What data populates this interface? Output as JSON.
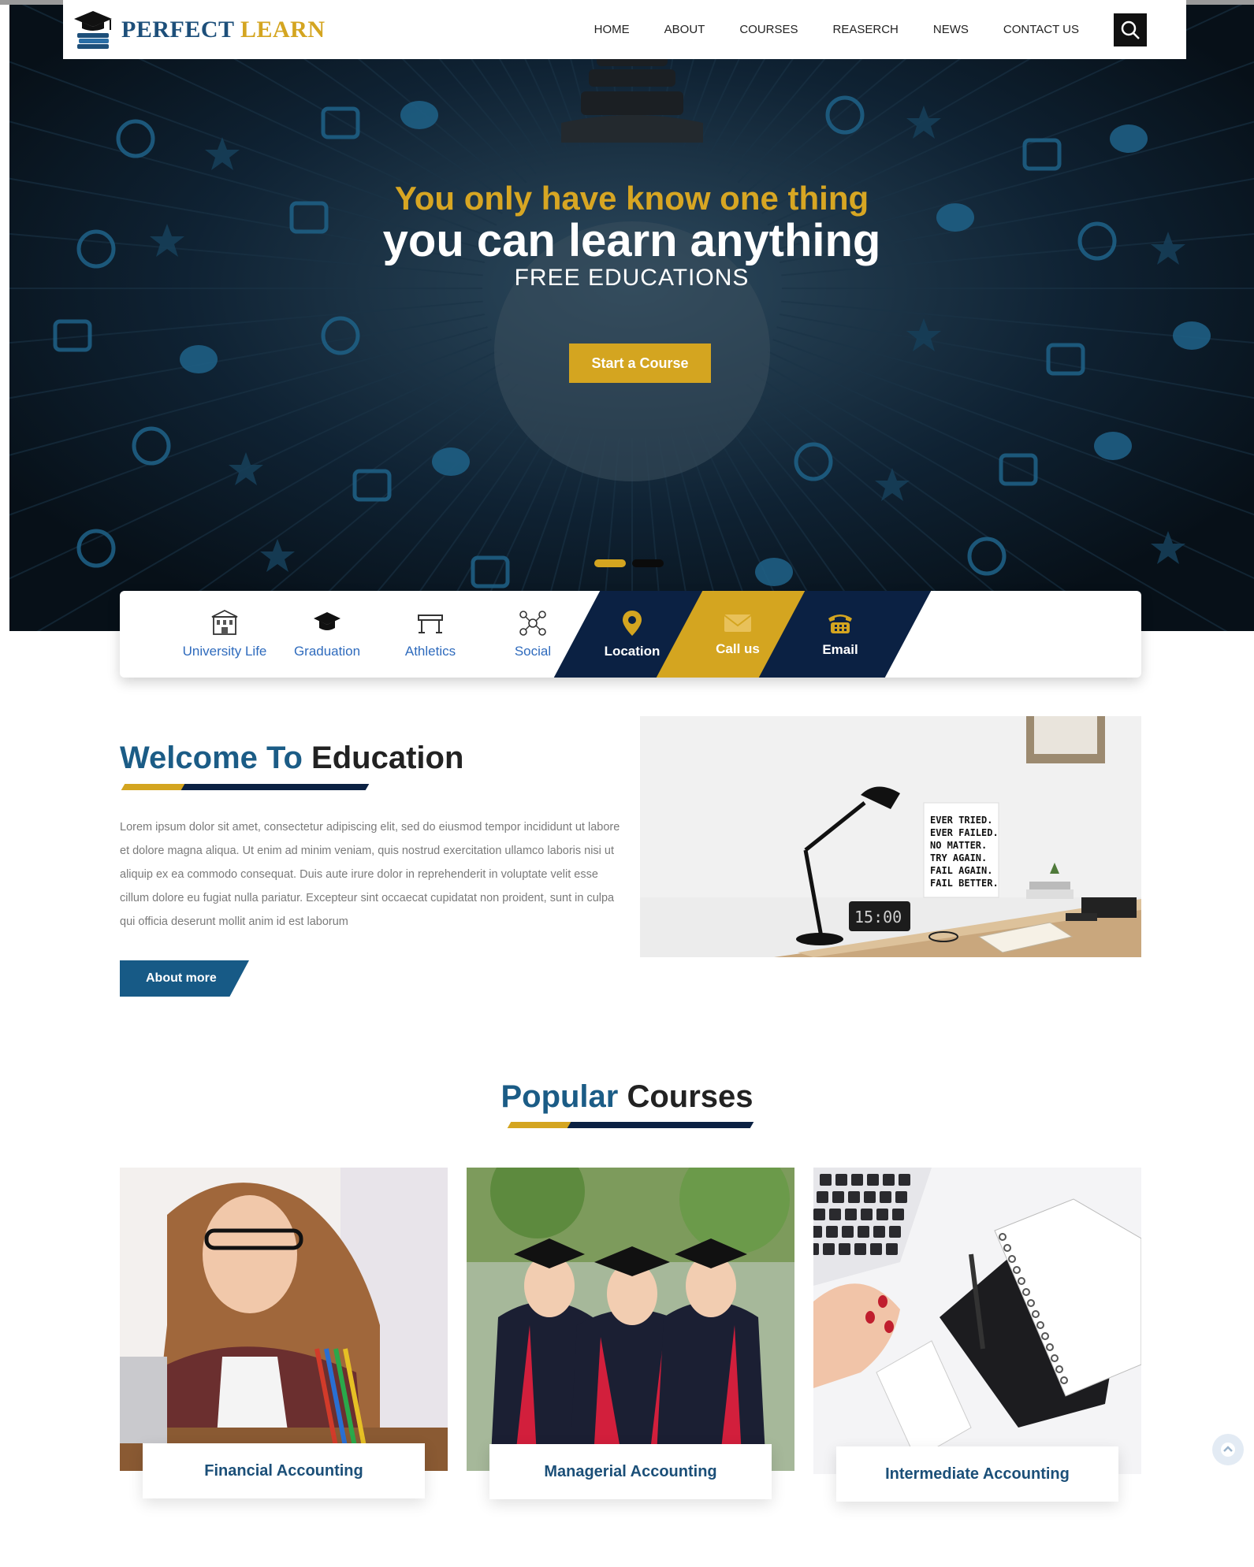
{
  "brand": {
    "name_part1": "PERFECT",
    "name_part2": "LEARN"
  },
  "nav": {
    "items": [
      {
        "label": "HOME"
      },
      {
        "label": "ABOUT"
      },
      {
        "label": "COURSES"
      },
      {
        "label": "REASERCH"
      },
      {
        "label": "NEWS"
      },
      {
        "label": "CONTACT US"
      }
    ],
    "search_icon": "search-icon"
  },
  "hero": {
    "line1": "You only have know one thing",
    "line2": "you can learn anything",
    "line3": "FREE EDUCATIONS",
    "cta_label": "Start a Course",
    "slides": 2,
    "active_slide": 1
  },
  "features": [
    {
      "label": "University Life",
      "icon": "university-building-icon"
    },
    {
      "label": "Graduation",
      "icon": "graduation-cap-icon"
    },
    {
      "label": "Athletics",
      "icon": "hurdle-icon"
    },
    {
      "label": "Social",
      "icon": "social-network-icon"
    },
    {
      "label": "Location",
      "icon": "map-pin-icon"
    },
    {
      "label": "Call us",
      "icon": "envelope-icon"
    },
    {
      "label": "Email",
      "icon": "telephone-icon"
    }
  ],
  "welcome": {
    "title_highlight": "Welcome To",
    "title_rest": "Education",
    "body": "Lorem ipsum dolor sit amet, consectetur adipiscing elit, sed do eiusmod tempor incididunt ut labore et dolore magna aliqua. Ut enim ad minim veniam, quis nostrud exercitation ullamco laboris nisi ut aliquip ex ea commodo consequat. Duis aute irure dolor in reprehenderit in voluptate velit esse cillum dolore eu fugiat nulla pariatur. Excepteur sint occaecat cupidatat non proident, sunt in culpa qui officia deserunt mollit anim id est laborum",
    "button_label": "About more",
    "image_poster_text": [
      "EVER TRIED.",
      "EVER FAILED.",
      "NO MATTER.",
      "TRY AGAIN.",
      "FAIL AGAIN.",
      "FAIL BETTER."
    ],
    "image_clock_text": "15:00"
  },
  "courses": {
    "title_highlight": "Popular",
    "title_rest": "Courses",
    "items": [
      {
        "label": "Financial Accounting"
      },
      {
        "label": "Managerial Accounting"
      },
      {
        "label": "Intermediate Accounting"
      }
    ]
  },
  "colors": {
    "navy": "#0b2143",
    "gold": "#d4a520",
    "blue": "#1b5c86",
    "link": "#2f6bbd"
  }
}
